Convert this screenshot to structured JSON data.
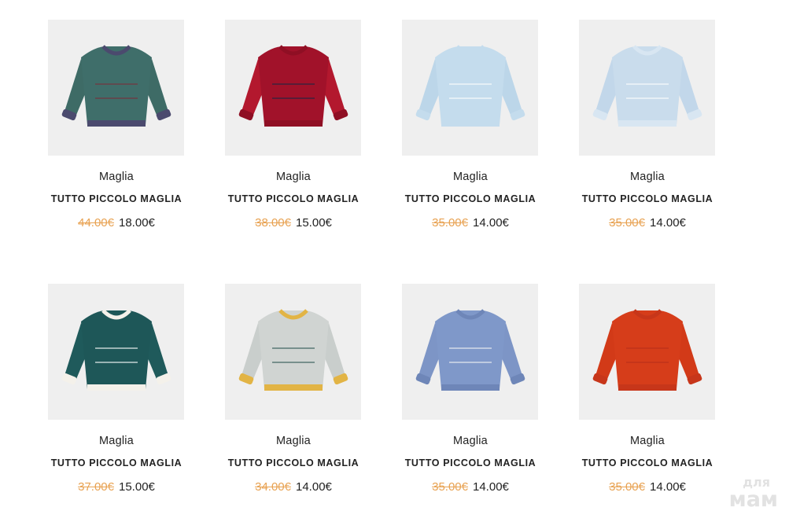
{
  "products": [
    {
      "category": "Maglia",
      "title": "TUTTO PICCOLO MAGLIA",
      "old_price": "44.00€",
      "price": "18.00€",
      "colors": {
        "body": "#3f6e6a",
        "sleeve": "#3e6b66",
        "accent": "#7a2f3a",
        "trim": "#4b4a6e"
      }
    },
    {
      "category": "Maglia",
      "title": "TUTTO PICCOLO MAGLIA",
      "old_price": "38.00€",
      "price": "15.00€",
      "colors": {
        "body": "#a1122a",
        "sleeve": "#b3182e",
        "accent": "#1e2742",
        "trim": "#8f0f24"
      }
    },
    {
      "category": "Maglia",
      "title": "TUTTO PICCOLO MAGLIA",
      "old_price": "35.00€",
      "price": "14.00€",
      "colors": {
        "body": "#c4dced",
        "sleeve": "#bcd6e9",
        "accent": "#ffffff",
        "trim": "#c4dced"
      }
    },
    {
      "category": "Maglia",
      "title": "TUTTO PICCOLO MAGLIA",
      "old_price": "35.00€",
      "price": "14.00€",
      "colors": {
        "body": "#c9dcec",
        "sleeve": "#c2d7ea",
        "accent": "#ffffff",
        "trim": "#d8e6f2"
      }
    },
    {
      "category": "Maglia",
      "title": "TUTTO PICCOLO MAGLIA",
      "old_price": "37.00€",
      "price": "15.00€",
      "colors": {
        "body": "#1e5758",
        "sleeve": "#1f5a5b",
        "accent": "#ffffff",
        "trim": "#f4f1ea"
      }
    },
    {
      "category": "Maglia",
      "title": "TUTTO PICCOLO MAGLIA",
      "old_price": "34.00€",
      "price": "14.00€",
      "colors": {
        "body": "#d0d4d2",
        "sleeve": "#c9cecc",
        "accent": "#2f5a55",
        "trim": "#e2b445"
      }
    },
    {
      "category": "Maglia",
      "title": "TUTTO PICCOLO MAGLIA",
      "old_price": "35.00€",
      "price": "14.00€",
      "colors": {
        "body": "#7f98c9",
        "sleeve": "#7d95c6",
        "accent": "#f3f3f3",
        "trim": "#6e86b8"
      }
    },
    {
      "category": "Maglia",
      "title": "TUTTO PICCOLO MAGLIA",
      "old_price": "35.00€",
      "price": "14.00€",
      "colors": {
        "body": "#d63d1a",
        "sleeve": "#d23a18",
        "accent": "#b8301a",
        "trim": "#c7361a"
      }
    }
  ],
  "watermark": {
    "small": "для",
    "big": "мам"
  }
}
